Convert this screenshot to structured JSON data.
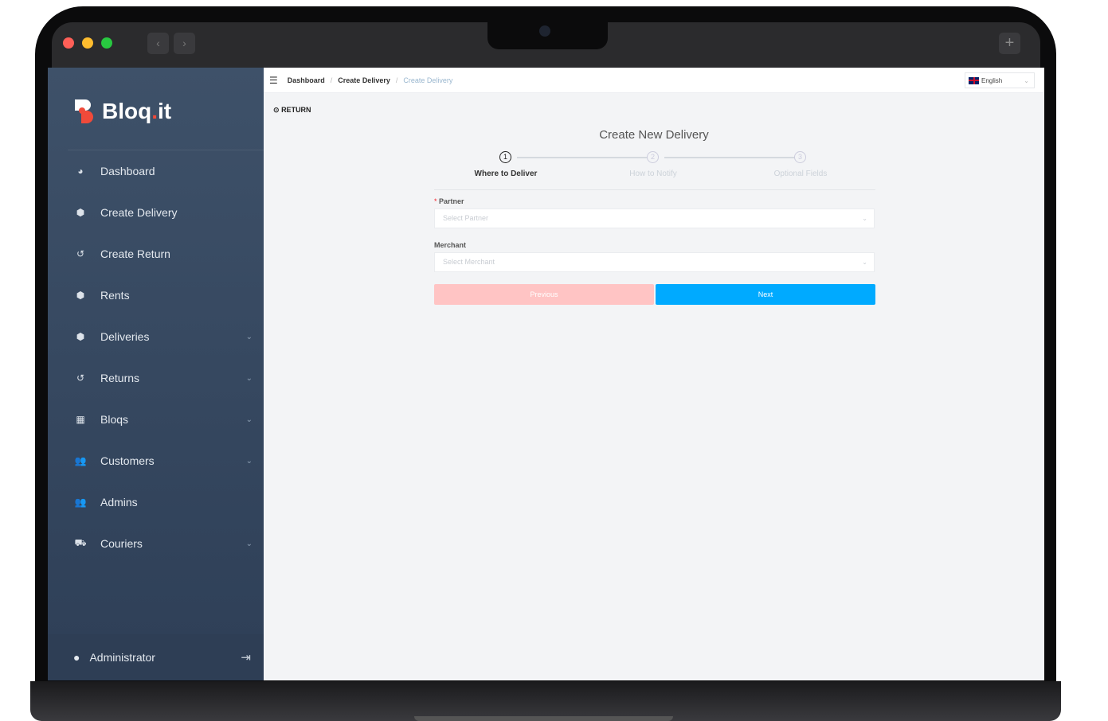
{
  "window": {
    "back_label": "‹",
    "forward_label": "›",
    "new_tab_label": "+"
  },
  "brand": {
    "name": "Bloq",
    "dot": ".",
    "suffix": "it",
    "accent": "#f04a3a"
  },
  "sidebar": {
    "items": [
      {
        "label": "Dashboard",
        "icon": "dashboard-icon",
        "glyph": "◕",
        "expandable": false
      },
      {
        "label": "Create Delivery",
        "icon": "box-icon",
        "glyph": "⬢",
        "expandable": false
      },
      {
        "label": "Create Return",
        "icon": "return-icon",
        "glyph": "↺",
        "expandable": false
      },
      {
        "label": "Rents",
        "icon": "box-icon",
        "glyph": "⬢",
        "expandable": false
      },
      {
        "label": "Deliveries",
        "icon": "box-icon",
        "glyph": "⬢",
        "expandable": true
      },
      {
        "label": "Returns",
        "icon": "return-icon",
        "glyph": "↺",
        "expandable": true
      },
      {
        "label": "Bloqs",
        "icon": "grid-icon",
        "glyph": "▦",
        "expandable": true
      },
      {
        "label": "Customers",
        "icon": "users-icon",
        "glyph": "👥",
        "expandable": true
      },
      {
        "label": "Admins",
        "icon": "users-icon",
        "glyph": "👥",
        "expandable": false
      },
      {
        "label": "Couriers",
        "icon": "courier-icon",
        "glyph": "⛟",
        "expandable": true
      }
    ],
    "chevron": "⌄",
    "user": "Administrator"
  },
  "header": {
    "breadcrumb": [
      "Dashboard",
      "Create Delivery",
      "Create Delivery"
    ],
    "separator": "/",
    "language": "English"
  },
  "page": {
    "return_label": "RETURN",
    "title": "Create New Delivery",
    "steps": [
      {
        "num": "1",
        "label": "Where to Deliver",
        "active": true
      },
      {
        "num": "2",
        "label": "How to Notify",
        "active": false
      },
      {
        "num": "3",
        "label": "Optional Fields",
        "active": false
      }
    ],
    "fields": {
      "partner": {
        "label": "Partner",
        "required_mark": "*",
        "placeholder": "Select Partner"
      },
      "merchant": {
        "label": "Merchant",
        "placeholder": "Select Merchant"
      }
    },
    "previous_label": "Previous",
    "next_label": "Next"
  },
  "colors": {
    "primary": "#00aaff",
    "previous_disabled": "#ffc4c4",
    "sidebar": "#3a4c64"
  }
}
